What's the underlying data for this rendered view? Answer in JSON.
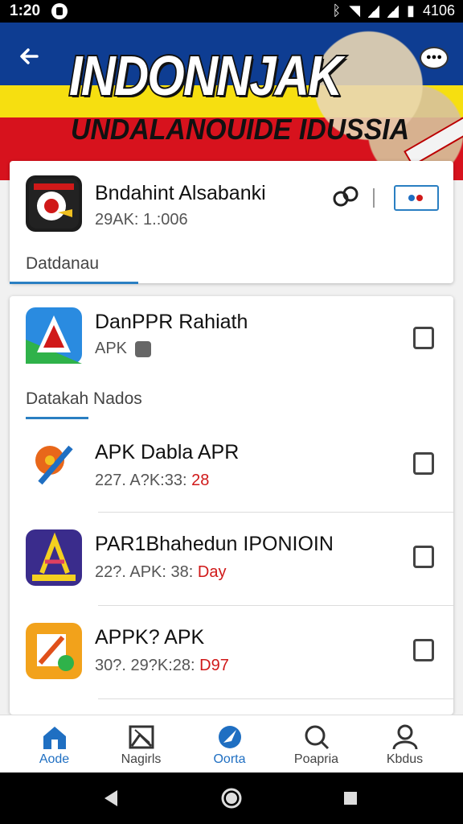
{
  "status": {
    "time": "1:20",
    "battery": "4106"
  },
  "header": {
    "title": "INDONNJAK",
    "subtitle": "UNDALANOUIDE IDUSSIA"
  },
  "card1": {
    "app_name": "Bndahint Alsabanki",
    "app_meta": "29AK: 1.:006",
    "section": "Datdanau"
  },
  "card2": {
    "app_name": "DanPPR Rahiath",
    "app_meta": "APK",
    "section": "Datakah Nados",
    "items": [
      {
        "name": "APK Dabla APR",
        "meta_prefix": "227. A?K:33:",
        "meta_suffix": "28"
      },
      {
        "name": "PAR1Bhahedun IPONIOIN",
        "meta_prefix": "22?. APK: 38:",
        "meta_suffix": "Day"
      },
      {
        "name": "APPK? APK",
        "meta_prefix": "30?. 29?K:28:",
        "meta_suffix": "D97"
      }
    ]
  },
  "bottom_nav": [
    {
      "label": "Aode",
      "icon": "home-icon"
    },
    {
      "label": "Nagirls",
      "icon": "image-icon"
    },
    {
      "label": "Oorta",
      "icon": "compass-icon"
    },
    {
      "label": "Poapria",
      "icon": "search-icon"
    },
    {
      "label": "Kbdus",
      "icon": "person-icon"
    }
  ],
  "colors": {
    "accent": "#1f6fc2",
    "banner_blue": "#0e3d92",
    "banner_yellow": "#f6df10",
    "banner_red": "#d7121d"
  }
}
